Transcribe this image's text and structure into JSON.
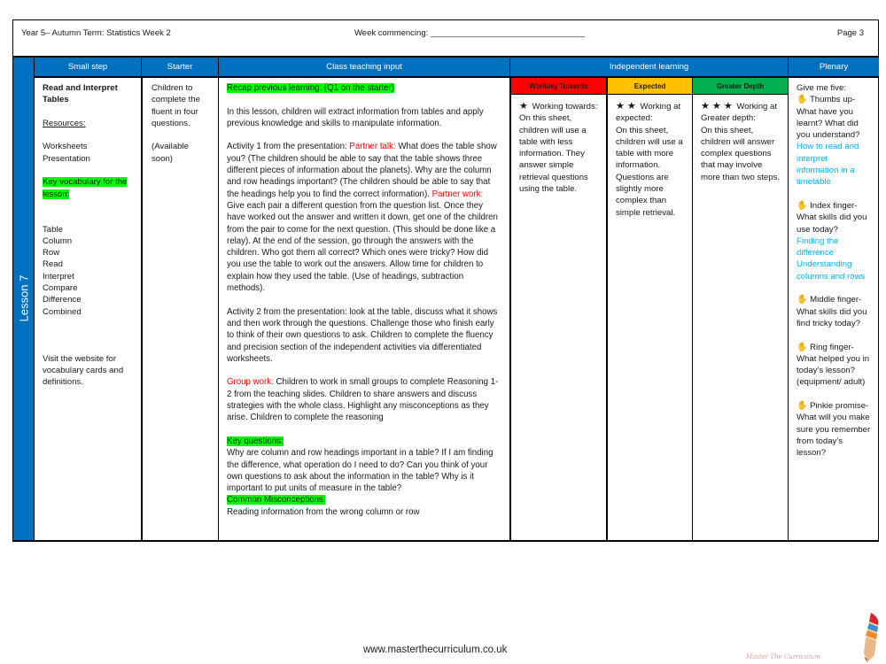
{
  "header": {
    "title": "Year 5– Autumn  Term: Statistics Week 2",
    "week_commencing": "Week commencing: _________________________________",
    "page": "Page 3"
  },
  "lesson_label": "Lesson 7",
  "columns": {
    "small_step": "Small step",
    "starter": "Starter",
    "class_teaching": "Class teaching input",
    "independent": "Independent learning",
    "plenary": "Plenary"
  },
  "small_step": {
    "title_line1": "Read and Interpret",
    "title_line2": "Tables",
    "resources_label": "Resources:",
    "resources": [
      "Worksheets",
      "Presentation"
    ],
    "vocab_label": "Key vocabulary for the lesson:",
    "vocab": [
      "Table",
      "Column",
      "Row",
      "Read",
      "Interpret",
      "Compare",
      "Difference",
      "Combined"
    ],
    "website_note": "Visit the website for vocabulary cards and definitions."
  },
  "starter": {
    "text": "Children to complete the fluent in four questions.",
    "availability": "(Available soon)"
  },
  "teaching": {
    "recap": "Recap previous learning: (Q1 on the starter)",
    "intro": "In this lesson, children will extract information from tables and apply previous knowledge and skills to manipulate information.",
    "activity1_prefix": "Activity 1 from the presentation: ",
    "partner_talk_label": "Partner talk:",
    "activity1_part1": " What does the table show you? (The children should be able to say that the table shows three different pieces of information about the planets). Why are the column and row headings important? (The children should be able to say that the headings help you to find the correct information).  ",
    "partner_work_label": "Partner work:",
    "activity1_part2": " Give each pair a different question from the question list. Once they have worked out the answer and written it down, get one of the children from the pair to come for the next question. (This should be done like a relay). At the end of the session, go through the answers with the children. Who got them all correct? Which ones were tricky? How did you use the table to work out the answers. Allow time for children to explain how they used the table. (Use of headings, subtraction methods).",
    "activity2": "Activity 2 from the presentation: look at the table, discuss what it shows and then work through the questions. Challenge those who finish early to think of their own questions to ask. Children to complete the fluency and precision section of the  independent activities via differentiated worksheets.",
    "group_work_label": "Group work:",
    "group_work": " Children to work in small groups to complete Reasoning 1-2 from the teaching slides. Children to share answers and discuss strategies with the whole class. Highlight any misconceptions as they arise. Children to complete the reasoning",
    "key_questions_label": "Key questions:",
    "key_questions": "Why are column and row headings important in a table? If I am finding the difference, what operation do I need to do? Can you think of your own questions to ask about the information in the table? Why is it important to put units of measure in the table?",
    "misconceptions_label": "Common Misconceptions:",
    "misconceptions": "Reading information from the wrong column or row"
  },
  "independent": {
    "working_towards": {
      "label": "Working Towards",
      "color": "#ff0000",
      "stars": "★",
      "text_head": " Working towards:",
      "text": "On this sheet, children will use a table with less information. They answer simple retrieval questions using the table."
    },
    "expected": {
      "label": "Expected",
      "color": "#ffc000",
      "stars": "★ ★",
      "text_head": " Working at expected:",
      "text": "On this sheet, children will use a table with more information. Questions are slightly more complex than simple retrieval."
    },
    "greater_depth": {
      "label": "Greater Depth",
      "color": "#00b050",
      "stars": "★ ★ ★",
      "text_head": " Working at Greater depth:",
      "text": "On this sheet, children will answer complex questions that may involve more than two steps."
    }
  },
  "plenary": {
    "intro": "Give me five:",
    "thumb": " Thumbs up- What have you learnt? What did you understand?",
    "thumb_answer": "How to read and interpret information in a timetable",
    "index": " Index finger- What skills did you use today?",
    "index_answer_1": "Finding the difference",
    "index_answer_2": "Understanding columns and rows",
    "middle": " Middle finger- What skills did you find tricky today?",
    "ring": " Ring finger- What helped you in today’s lesson? (equipment/ adult)",
    "pinkie": " Pinkie promise- What will you make sure you remember from today’s lesson?"
  },
  "footer": {
    "url": "www.masterthecurriculum.co.uk",
    "logo_text": "Master  The  Curriculum"
  }
}
